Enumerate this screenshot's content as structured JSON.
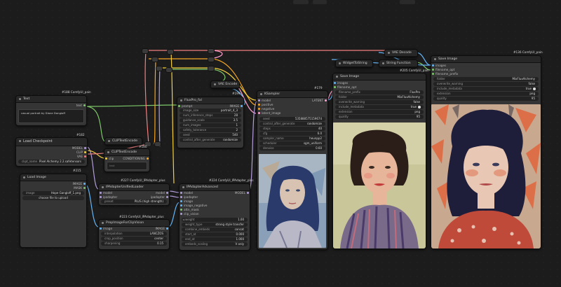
{
  "badges": {
    "text_node": "#188 ComfyUI_pain",
    "load_checkpoint": "#182",
    "clip_text_encode": "#180",
    "clip_text_encode2": "#215",
    "ipadapter_unified": "#227 ComfyUI_IPAdapter_plus",
    "prep_clip": "#223 ComfyUI_IPAdapter_plus",
    "ipadapter_adv": "#224 ComfyUI_IPAdapter_plus",
    "fluxpro": "#199",
    "ksampler": "#179",
    "save_image_mid": "#205 ComfyUI_pain",
    "save_image_right": "#136 ComfyUI_pain"
  },
  "text_node": {
    "title": "Text",
    "output": "text",
    "content": "casual portrait by Diane Dongioff"
  },
  "load_checkpoint": {
    "title": "Load Checkpoint",
    "outputs": [
      "MODEL",
      "CLIP",
      "VAE"
    ],
    "ckpt_label": "ckpt_name",
    "ckpt_value": "Pixel Alchemy 2.2.safetensors"
  },
  "clip_text_encode": {
    "title": "CLIPTextEncode",
    "title2": "CLIPTextEncode",
    "input": "clip",
    "output": "CONDITIONING",
    "text_placeholder": "text"
  },
  "load_image": {
    "title": "Load Image",
    "outputs": [
      "IMAGE",
      "MASK"
    ],
    "image_label": "image",
    "image_value": "Hope Gangloff_1.png",
    "upload_button": "choose file to upload"
  },
  "ipadapter_unified": {
    "title": "IPAdapterUnifiedLoader",
    "inputs": [
      "model",
      "ipadapter"
    ],
    "outputs": [
      "model",
      "ipadapter"
    ],
    "preset_label": "preset",
    "preset_value": "PLUS (high strength)"
  },
  "prep_clip": {
    "title": "PrepImageForClipVision",
    "input": "image",
    "output": "IMAGE",
    "widgets": [
      {
        "k": "interpolation",
        "v": "LANCZOS"
      },
      {
        "k": "crop_position",
        "v": "center"
      },
      {
        "k": "sharpening",
        "v": "0.15"
      }
    ]
  },
  "ipadapter_adv": {
    "title": "IPAdapterAdvanced",
    "inputs": [
      "model",
      "ipadapter",
      "image",
      "image_negative",
      "attn_mask",
      "clip_vision"
    ],
    "output": "MODEL",
    "widgets": [
      {
        "k": "weight",
        "v": "1.00"
      },
      {
        "k": "weight_type",
        "v": "strong style transfer"
      },
      {
        "k": "combine_embeds",
        "v": "concat"
      },
      {
        "k": "start_at",
        "v": "0.000"
      },
      {
        "k": "end_at",
        "v": "1.000"
      },
      {
        "k": "embeds_scaling",
        "v": "V only"
      }
    ]
  },
  "fluxpro": {
    "title": "FluxPro_fal",
    "input": "prompt",
    "output": "IMAGE",
    "widgets": [
      {
        "k": "image_size",
        "v": "portrait_4_3"
      },
      {
        "k": "num_inference_steps",
        "v": "28"
      },
      {
        "k": "guidance_scale",
        "v": "3.5"
      },
      {
        "k": "num_images",
        "v": "1"
      },
      {
        "k": "safety_tolerance",
        "v": "2"
      },
      {
        "k": "seed",
        "v": "540"
      },
      {
        "k": "control_after_generate",
        "v": "randomize"
      }
    ]
  },
  "vae_encode": {
    "title": "VAE Encode"
  },
  "vae_decode": {
    "title": "VAE Decode"
  },
  "widget_to_string": {
    "title": "WidgetToString"
  },
  "string_function": {
    "title": "String Function"
  },
  "ksampler": {
    "title": "KSampler",
    "inputs": [
      "model",
      "positive",
      "negative",
      "latent_image"
    ],
    "output": "LATENT",
    "widgets": [
      {
        "k": "seed",
        "v": "535888575159674"
      },
      {
        "k": "control_after_generate",
        "v": "randomize"
      },
      {
        "k": "steps",
        "v": "40"
      },
      {
        "k": "cfg",
        "v": "6.0"
      },
      {
        "k": "sampler_name",
        "v": "heunpp2"
      },
      {
        "k": "scheduler",
        "v": "sgm_uniform"
      },
      {
        "k": "denoise",
        "v": "0.60"
      }
    ]
  },
  "save_image_mid": {
    "title": "Save Image",
    "inputs": [
      "images",
      "filename_opt"
    ],
    "widgets": [
      {
        "k": "filename_prefix",
        "v": "FluxPro"
      },
      {
        "k": "folder",
        "v": "MixFluxAlchemy"
      },
      {
        "k": "overwrite_warning",
        "v": "false"
      },
      {
        "k": "include_metadata",
        "v": "true"
      },
      {
        "k": "extension",
        "v": "png"
      },
      {
        "k": "quality",
        "v": "95"
      }
    ]
  },
  "save_image_right": {
    "title": "Save Image",
    "inputs": [
      "images",
      "filename_opt",
      "filename_prefix"
    ],
    "widgets": [
      {
        "k": "folder",
        "v": "MixFluxAlchemy"
      },
      {
        "k": "overwrite_warning",
        "v": "false"
      },
      {
        "k": "include_metadata",
        "v": "true"
      },
      {
        "k": "extension",
        "v": "png"
      },
      {
        "k": "quality",
        "v": "95"
      }
    ]
  },
  "colors": {
    "canvas": "#1c1c1c",
    "node": "#353535",
    "node_header": "#272727",
    "wire_model": "#b39ddb",
    "wire_clip": "#f4d03f",
    "wire_vae": "#f08080",
    "wire_image": "#64b5f6",
    "wire_latent": "#ff9fd0",
    "wire_conditioning": "#f5a623",
    "wire_string": "#7ec96a"
  }
}
